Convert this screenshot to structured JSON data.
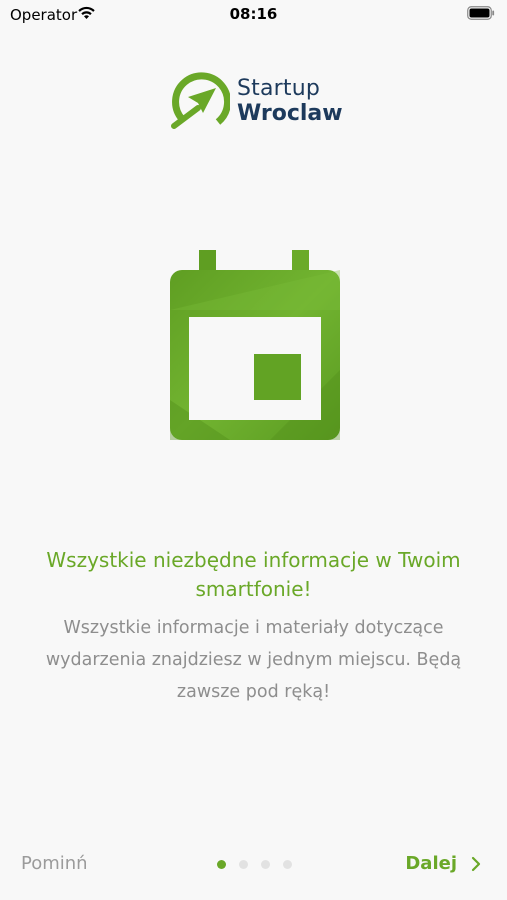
{
  "status_bar": {
    "carrier": "Operator",
    "time": "08:16"
  },
  "logo": {
    "line1": "Startup",
    "line2": "Wroclaw"
  },
  "onboarding": {
    "headline": "Wszystkie niezbędne informacje w Twoim smartfonie!",
    "body": "Wszystkie informacje i materiały dotyczące wydarzenia znajdziesz w jednym miejscu. Będą zawsze pod ręką!",
    "illustration_icon": "calendar-icon"
  },
  "nav": {
    "skip_label": "Pominń",
    "next_label": "Dalej",
    "page_count": 4,
    "current_page": 1
  },
  "colors": {
    "accent": "#6aa828",
    "brand_navy": "#1d3a5c",
    "muted_text": "#8e8e8e",
    "background": "#f8f8f8"
  }
}
